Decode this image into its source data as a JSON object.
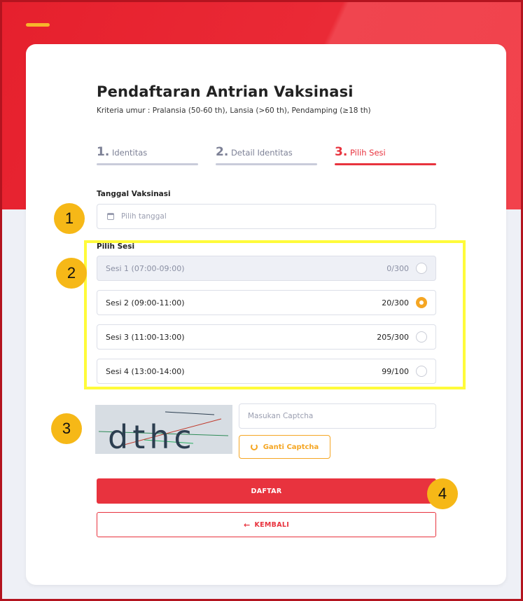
{
  "form": {
    "title": "Pendaftaran Antrian Vaksinasi",
    "subtitle": "Kriteria umur : Pralansia (50-60 th), Lansia (>60 th), Pendamping (≥18 th)"
  },
  "steps": [
    {
      "num": "1.",
      "label": "Identitas",
      "active": false
    },
    {
      "num": "2.",
      "label": "Detail Identitas",
      "active": false
    },
    {
      "num": "3.",
      "label": "Pilih Sesi",
      "active": true
    }
  ],
  "date_field": {
    "label": "Tanggal Vaksinasi",
    "placeholder": "Pilih tanggal"
  },
  "session_field": {
    "label": "Pilih Sesi",
    "sessions": [
      {
        "label": "Sesi 1 (07:00-09:00)",
        "quota": "0/300",
        "disabled": true,
        "selected": false
      },
      {
        "label": "Sesi 2 (09:00-11:00)",
        "quota": "20/300",
        "disabled": false,
        "selected": true
      },
      {
        "label": "Sesi 3 (11:00-13:00)",
        "quota": "205/300",
        "disabled": false,
        "selected": false
      },
      {
        "label": "Sesi 4 (13:00-14:00)",
        "quota": "99/100",
        "disabled": false,
        "selected": false
      }
    ]
  },
  "captcha": {
    "text": "dthc",
    "placeholder": "Masukan Captcha",
    "refresh_label": "Ganti Captcha"
  },
  "actions": {
    "submit_label": "DAFTAR",
    "back_label": "KEMBALI"
  },
  "annotations": [
    "1",
    "2",
    "3",
    "4"
  ],
  "colors": {
    "primary": "#e8333e",
    "accent": "#f5a623",
    "highlight": "#fffb3a",
    "badge": "#f6b817"
  }
}
